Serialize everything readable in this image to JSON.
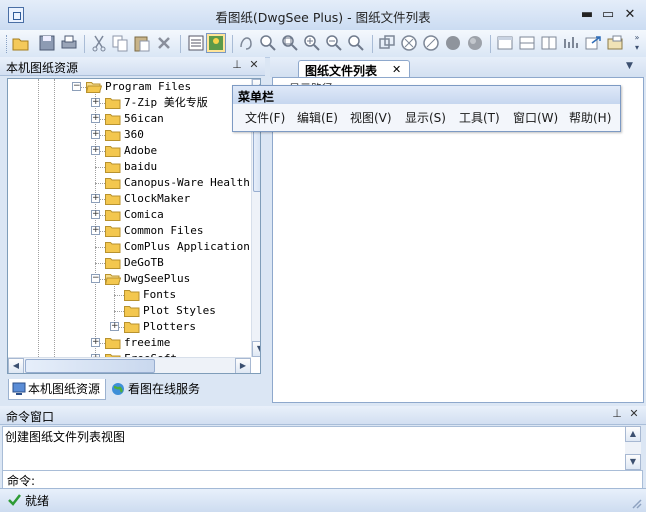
{
  "window": {
    "title": "看图纸(DwgSee Plus) - 图纸文件列表"
  },
  "title_buttons": {
    "minimize": "▬",
    "maximize": "▭",
    "close": "✕"
  },
  "left_panel": {
    "title": "本机图纸资源",
    "pin_glyph": "⊥",
    "close_glyph": "✕",
    "tree": [
      {
        "label": "Program Files",
        "expander": "-",
        "open": true
      },
      {
        "label": "7-Zip 美化专版",
        "expander": "+"
      },
      {
        "label": "56ican",
        "expander": "+"
      },
      {
        "label": "360",
        "expander": "+"
      },
      {
        "label": "Adobe",
        "expander": "+"
      },
      {
        "label": "baidu",
        "expander": ""
      },
      {
        "label": "Canopus-Ware Health",
        "expander": ""
      },
      {
        "label": "ClockMaker",
        "expander": "+"
      },
      {
        "label": "Comica",
        "expander": "+"
      },
      {
        "label": "Common Files",
        "expander": "+"
      },
      {
        "label": "ComPlus Applications",
        "expander": ""
      },
      {
        "label": "DeGoTB",
        "expander": ""
      },
      {
        "label": "DwgSeePlus",
        "expander": "-",
        "open": true
      },
      {
        "label": "Fonts",
        "expander": ""
      },
      {
        "label": "Plot Styles",
        "expander": ""
      },
      {
        "label": "Plotters",
        "expander": "+"
      },
      {
        "label": "freeime",
        "expander": "+"
      },
      {
        "label": "FreeSoft",
        "expander": "+"
      }
    ],
    "tabs": [
      {
        "label": "本机图纸资源"
      },
      {
        "label": "看图在线服务"
      }
    ]
  },
  "right_panel": {
    "tab_label": "图纸文件列表",
    "tab_close": "✕",
    "dropdown_glyph": "▼",
    "path_label": "显示路径"
  },
  "menu_float": {
    "title": "菜单栏",
    "items": [
      "文件(F)",
      "编辑(E)",
      "视图(V)",
      "显示(S)",
      "工具(T)",
      "窗口(W)",
      "帮助(H)"
    ]
  },
  "command_window": {
    "title": "命令窗口",
    "output": "创建图纸文件列表视图",
    "prompt_label": "命令:",
    "input_value": ""
  },
  "statusbar": {
    "text": "就绪"
  },
  "colors": {
    "accent": "#2f5c9a",
    "folder": "#f3c74f",
    "panel_bg": "#dbe6f4"
  }
}
